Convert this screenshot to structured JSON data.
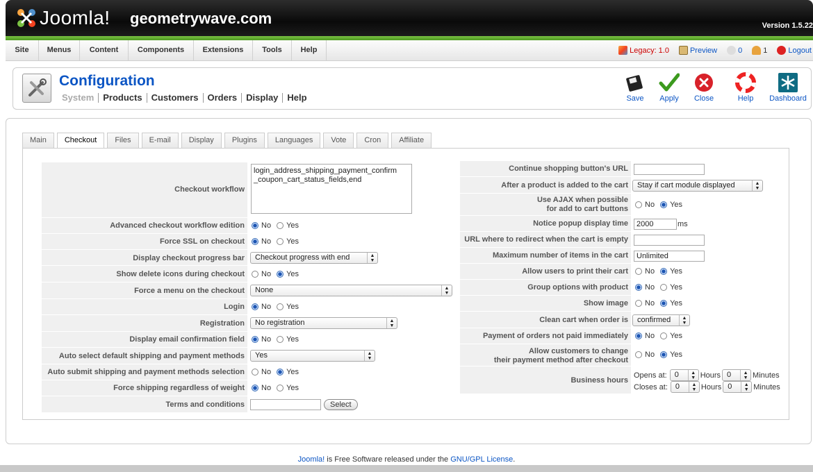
{
  "header": {
    "logo_text": "Joomla!",
    "site_name": "geometrywave.com",
    "version": "Version 1.5.22"
  },
  "menu": {
    "items": [
      "Site",
      "Menus",
      "Content",
      "Components",
      "Extensions",
      "Tools",
      "Help"
    ]
  },
  "status": {
    "legacy": "Legacy: 1.0",
    "preview": "Preview",
    "messages": "0",
    "users": "1",
    "logout": "Logout"
  },
  "toolbar": {
    "title": "Configuration",
    "subnav": [
      "System",
      "Products",
      "Customers",
      "Orders",
      "Display",
      "Help"
    ],
    "buttons": {
      "save": "Save",
      "apply": "Apply",
      "close": "Close",
      "help": "Help",
      "dashboard": "Dashboard"
    }
  },
  "tabs": [
    "Main",
    "Checkout",
    "Files",
    "E-mail",
    "Display",
    "Plugins",
    "Languages",
    "Vote",
    "Cron",
    "Affiliate"
  ],
  "active_tab": "Checkout",
  "radio_labels": {
    "no": "No",
    "yes": "Yes"
  },
  "left": {
    "checkout_workflow": {
      "label": "Checkout workflow",
      "value": "login_address_shipping_payment_confirm\n_coupon_cart_status_fields,end"
    },
    "advanced_workflow": {
      "label": "Advanced checkout workflow edition",
      "selected": "No"
    },
    "force_ssl": {
      "label": "Force SSL on checkout",
      "selected": "No"
    },
    "progress_bar": {
      "label": "Display checkout progress bar",
      "value": "Checkout progress with end"
    },
    "delete_icons": {
      "label": "Show delete icons during checkout",
      "selected": "Yes"
    },
    "force_menu": {
      "label": "Force a menu on the checkout",
      "value": "None"
    },
    "login": {
      "label": "Login",
      "selected": "No"
    },
    "registration": {
      "label": "Registration",
      "value": "No registration"
    },
    "email_confirm": {
      "label": "Display email confirmation field",
      "selected": "No"
    },
    "auto_select": {
      "label": "Auto select default shipping and payment methods",
      "value": "Yes"
    },
    "auto_submit": {
      "label": "Auto submit shipping and payment methods selection",
      "selected": "Yes"
    },
    "force_shipping": {
      "label": "Force shipping regardless of weight",
      "selected": "No"
    },
    "terms": {
      "label": "Terms and conditions",
      "value": "",
      "button": "Select"
    }
  },
  "right": {
    "continue_url": {
      "label": "Continue shopping button's URL",
      "value": ""
    },
    "after_add": {
      "label": "After a product is added to the cart",
      "value": "Stay if cart module displayed"
    },
    "use_ajax": {
      "label_1": "Use AJAX when possible",
      "label_2": "for add to cart buttons",
      "selected": "Yes"
    },
    "popup_time": {
      "label": "Notice popup display time",
      "value": "2000",
      "unit": "ms"
    },
    "redirect_url": {
      "label": "URL where to redirect when the cart is empty",
      "value": ""
    },
    "max_items": {
      "label": "Maximum number of items in the cart",
      "value": "Unlimited"
    },
    "print_cart": {
      "label": "Allow users to print their cart",
      "selected": "Yes"
    },
    "group_options": {
      "label": "Group options with product",
      "selected": "No"
    },
    "show_image": {
      "label": "Show image",
      "selected": "Yes"
    },
    "clean_cart": {
      "label": "Clean cart when order is",
      "value": "confirmed"
    },
    "payment_not_paid": {
      "label": "Payment of orders not paid immediately",
      "selected": "No"
    },
    "change_payment": {
      "label_1": "Allow customers to change",
      "label_2": "their payment method after checkout",
      "selected": "Yes"
    },
    "business_hours": {
      "label": "Business hours",
      "opens": "Opens at:",
      "closes": "Closes at:",
      "hours_label": "Hours",
      "minutes_label": "Minutes",
      "open_h": "0",
      "open_m": "0",
      "close_h": "0",
      "close_m": "0"
    }
  },
  "footer": {
    "link1": "Joomla!",
    "text": " is Free Software released under the ",
    "link2": "GNU/GPL License",
    "end": "."
  }
}
